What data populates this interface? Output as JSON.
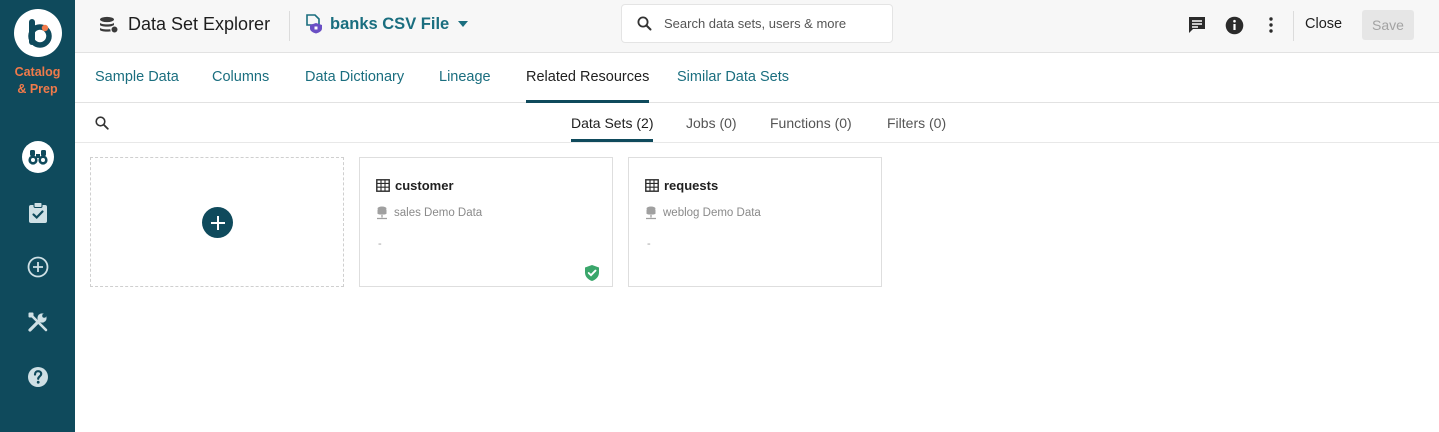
{
  "brand": {
    "line1": "Catalog",
    "line2": "& Prep"
  },
  "colors": {
    "rail": "#0f4a5c",
    "accent": "#1a6e7f",
    "brand": "#f07a4a",
    "verified": "#3aa66b"
  },
  "header": {
    "title": "Data Set Explorer",
    "dataset_name": "banks CSV File",
    "search": {
      "placeholder": "Search data sets, users & more"
    },
    "close_label": "Close",
    "save_label": "Save"
  },
  "tabs": [
    {
      "label": "Sample Data"
    },
    {
      "label": "Columns"
    },
    {
      "label": "Data Dictionary"
    },
    {
      "label": "Lineage"
    },
    {
      "label": "Related Resources",
      "active": true
    },
    {
      "label": "Similar Data Sets"
    }
  ],
  "subtabs": [
    {
      "label": "Data Sets (2)",
      "active": true
    },
    {
      "label": "Jobs (0)"
    },
    {
      "label": "Functions (0)"
    },
    {
      "label": "Filters (0)"
    }
  ],
  "cards": [
    {
      "name": "customer",
      "source": "sales Demo Data",
      "description": "-",
      "verified": true
    },
    {
      "name": "requests",
      "source": "weblog Demo Data",
      "description": "-",
      "verified": false
    }
  ]
}
